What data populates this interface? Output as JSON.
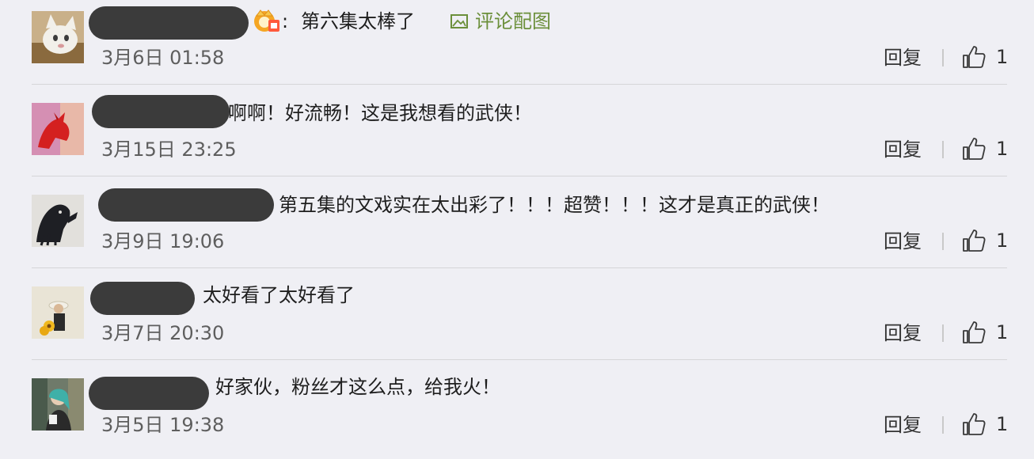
{
  "reply_label": "回复",
  "comments": [
    {
      "text": "第六集太棒了",
      "colon": ":",
      "pic_link": "评论配图",
      "time": "3月6日 01:58",
      "likes": "1"
    },
    {
      "text": "啊啊！好流畅！这是我想看的武侠！",
      "time": "3月15日 23:25",
      "likes": "1"
    },
    {
      "text": "第五集的文戏实在太出彩了！！！超赞！！！这才是真正的武侠！",
      "time": "3月9日 19:06",
      "likes": "1"
    },
    {
      "text": "太好看了太好看了",
      "time": "3月7日 20:30",
      "likes": "1"
    },
    {
      "text": "好家伙，粉丝才这么点，给我火！",
      "time": "3月5日 19:38",
      "likes": "1"
    }
  ],
  "colors": {
    "background": "#efeff4",
    "name_mask": "#3b3b3b",
    "pic_link": "#6b8f3a",
    "divider": "#d5d5d8"
  }
}
